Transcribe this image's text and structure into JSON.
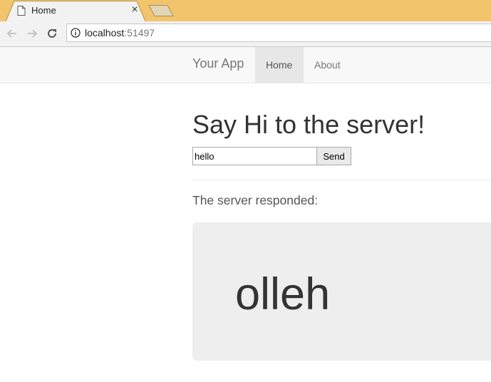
{
  "browser": {
    "tab_title": "Home",
    "tab_close_glyph": "×",
    "url_host": "localhost",
    "url_port": ":51497"
  },
  "app": {
    "brand": "Your App",
    "nav": [
      {
        "label": "Home",
        "active": true
      },
      {
        "label": "About",
        "active": false
      }
    ]
  },
  "main": {
    "heading": "Say Hi to the server!",
    "input_value": "hello",
    "send_label": "Send",
    "responded_label": "The server responded:",
    "response": "olleh"
  },
  "icons": {
    "tab": "page-icon",
    "back": "arrow-left-icon",
    "forward": "arrow-right-icon",
    "reload": "reload-icon",
    "site_info": "info-icon"
  },
  "colors": {
    "tabstrip": "#f2c46b",
    "navbar": "#f8f8f8",
    "nav_active": "#e7e7e7",
    "jumbotron": "#eeeeee"
  }
}
